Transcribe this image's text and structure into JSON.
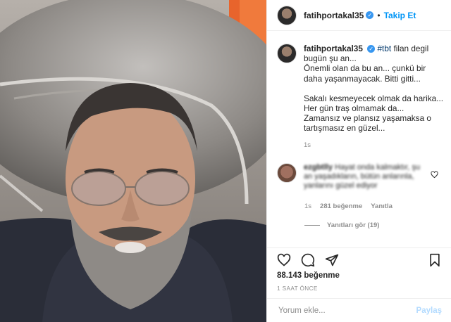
{
  "header": {
    "username": "fatihportakal35",
    "verified": true,
    "separator": "•",
    "follow_label": "Takip Et"
  },
  "caption": {
    "username": "fatihportakal35",
    "hashtag": "#tbt",
    "line1_rest": " filan degil",
    "line2": "bugün şu an...",
    "line3": "Önemli olan da bu an... çunkü bir daha yaşanmayacak. Bitti gitti...",
    "line4": "Sakalı kesmeyecek olmak da harika...",
    "line5": "Her gün traş olmamak da...",
    "line6": "Zamansız ve plansız yaşamaksa o tartışmasız en güzel...",
    "time": "1s"
  },
  "comment": {
    "username": "ezgbtlly",
    "text": "Hayat onda kalmaktır, şu an yaşadıkların, bütün anlarınla, yanlarını güzel ediyor",
    "time": "1s",
    "likes": "281 beğenme",
    "reply_label": "Yanıtla",
    "view_replies": "Yanıtları gör (19)"
  },
  "actions": {
    "icons": [
      "heart-icon",
      "comment-icon",
      "share-icon",
      "bookmark-icon"
    ]
  },
  "likes": "88.143 beğenme",
  "time_ago": "1 SAAT ÖNCE",
  "add_comment": {
    "placeholder": "Yorum ekle...",
    "post_label": "Paylaş"
  },
  "colors": {
    "link": "#0095f6",
    "verified": "#3897f0",
    "muted": "#8e8e8e",
    "post_disabled": "#b3dbff"
  }
}
